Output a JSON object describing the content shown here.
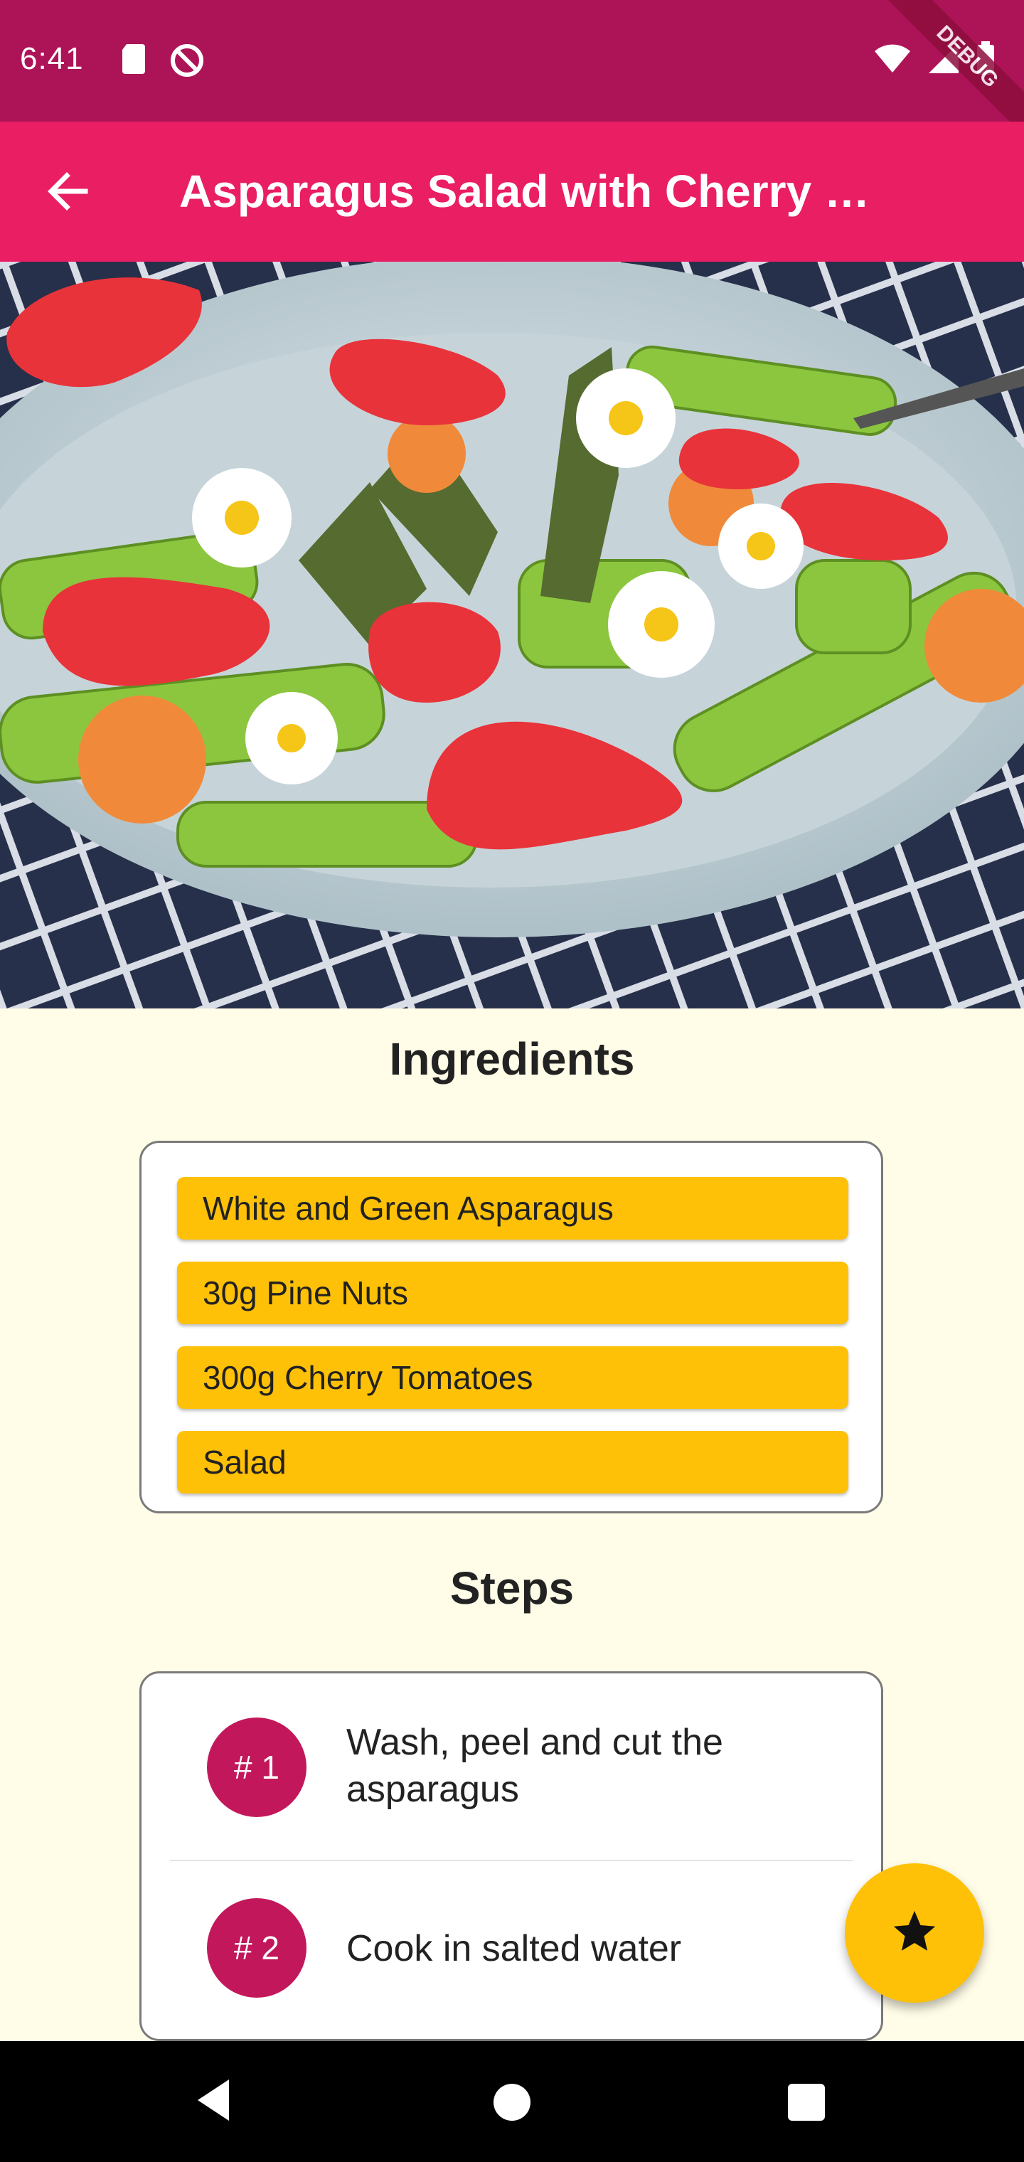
{
  "status_bar": {
    "time": "6:41",
    "left_icons": [
      "sd-card-icon",
      "do-not-disturb-icon"
    ],
    "right_icons": [
      "wifi-icon",
      "signal-icon",
      "battery-icon"
    ],
    "debug_label": "DEBUG",
    "background": "#AD1457"
  },
  "app_bar": {
    "title": "Asparagus Salad with Cherry …",
    "back_icon": "arrow-back-icon",
    "background": "#E91E63"
  },
  "hero": {
    "subject": "salad-photo"
  },
  "ingredients": {
    "title": "Ingredients",
    "items": [
      "White and Green Asparagus",
      "30g Pine Nuts",
      "300g Cherry Tomatoes",
      "Salad"
    ],
    "item_color": "#FFC107"
  },
  "steps": {
    "title": "Steps",
    "items": [
      {
        "badge": "# 1",
        "text": "Wash, peel and cut the asparagus"
      },
      {
        "badge": "# 2",
        "text": "Cook in salted water"
      }
    ],
    "badge_color": "#C2185B"
  },
  "fab": {
    "icon": "star-icon",
    "color": "#FFC107"
  },
  "nav_bar": {
    "icons": [
      "nav-back-icon",
      "nav-home-icon",
      "nav-recents-icon"
    ]
  }
}
